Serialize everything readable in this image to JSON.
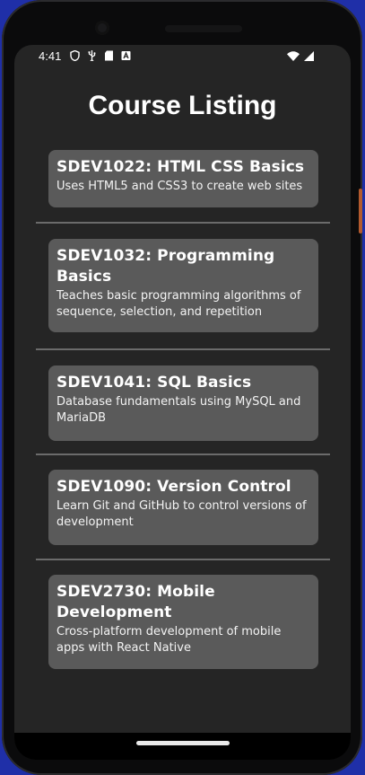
{
  "status_bar": {
    "time": "4:41",
    "left_icons": [
      "shield-icon",
      "usb-icon",
      "sd-card-icon",
      "text-a-icon"
    ],
    "right_icons": [
      "wifi-icon",
      "signal-icon"
    ]
  },
  "header": {
    "title": "Course Listing"
  },
  "courses": [
    {
      "title": "SDEV1022: HTML CSS Basics",
      "description": "Uses HTML5 and CSS3 to create web sites"
    },
    {
      "title": "SDEV1032: Programming Basics",
      "description": "Teaches basic programming algorithms of sequence, selection, and repetition"
    },
    {
      "title": "SDEV1041: SQL Basics",
      "description": "Database fundamentals using MySQL and MariaDB"
    },
    {
      "title": "SDEV1090: Version Control",
      "description": "Learn Git and GitHub to control versions of development"
    },
    {
      "title": "SDEV2730: Mobile Development",
      "description": "Cross-platform development of mobile apps with React Native"
    }
  ],
  "colors": {
    "background": "#252525",
    "card": "#5a5a5a",
    "divider": "#6b6b6b",
    "text": "#ffffff"
  }
}
